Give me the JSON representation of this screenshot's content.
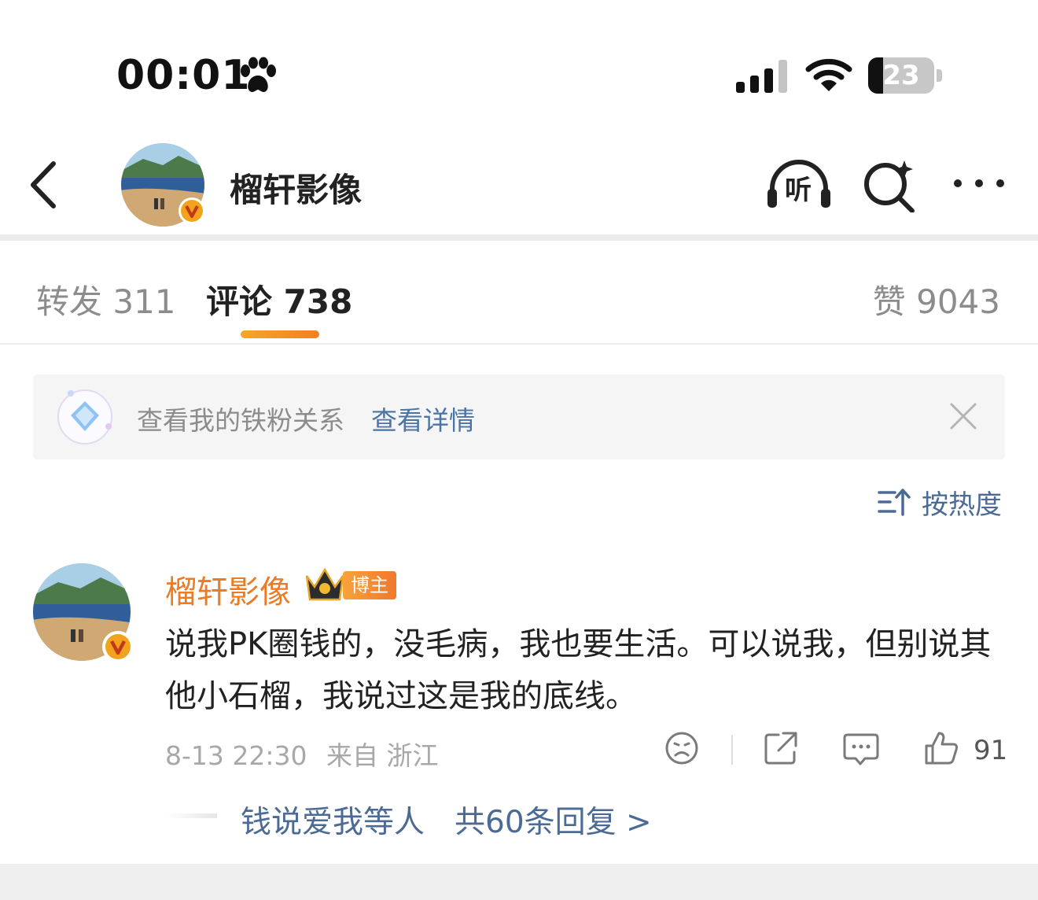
{
  "status_bar": {
    "time": "00:01",
    "battery_level": "23",
    "battery_fraction": 0.23,
    "icons": [
      "paw-icon",
      "signal-icon",
      "wifi-icon",
      "battery-icon"
    ]
  },
  "nav": {
    "title": "榴轩影像",
    "listen_label": "听",
    "icons": [
      "back-icon",
      "listen-icon",
      "search-icon",
      "more-icon"
    ]
  },
  "tabs": {
    "repost": "转发 311",
    "comment": "评论 738",
    "likes": "赞 9043"
  },
  "banner": {
    "text": "查看我的铁粉关系",
    "link": "查看详情"
  },
  "sort": {
    "label": "按热度"
  },
  "comment": {
    "author": "榴轩影像",
    "badge": "博主",
    "text": "说我PK圈钱的，没毛病，我也要生活。可以说我，但别说其他小石榴，我说过这是我的底线。",
    "time": "8-13 22:30",
    "location": "来自 浙江",
    "like_count": "91",
    "replies_who": "钱说爱我等人",
    "replies_total": "共60条回复 >"
  },
  "colors": {
    "accent_orange": "#eb7b25",
    "link_blue": "#4b6a95",
    "verified_badge": "#f2a31b"
  }
}
